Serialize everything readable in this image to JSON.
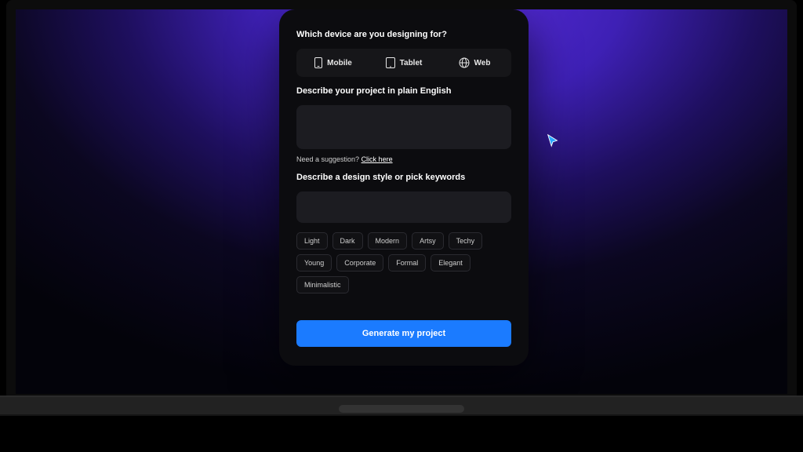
{
  "questions": {
    "device": "Which device are you designing for?",
    "describe_project": "Describe your project in plain English",
    "describe_style": "Describe a design style or pick keywords"
  },
  "devices": [
    {
      "label": "Mobile",
      "icon": "mobile"
    },
    {
      "label": "Tablet",
      "icon": "tablet"
    },
    {
      "label": "Web",
      "icon": "web"
    }
  ],
  "suggestion": {
    "text": "Need a suggestion? ",
    "link": "Click here"
  },
  "keywords": [
    "Light",
    "Dark",
    "Modern",
    "Artsy",
    "Techy",
    "Young",
    "Corporate",
    "Formal",
    "Elegant",
    "Minimalistic"
  ],
  "cta": "Generate my project"
}
